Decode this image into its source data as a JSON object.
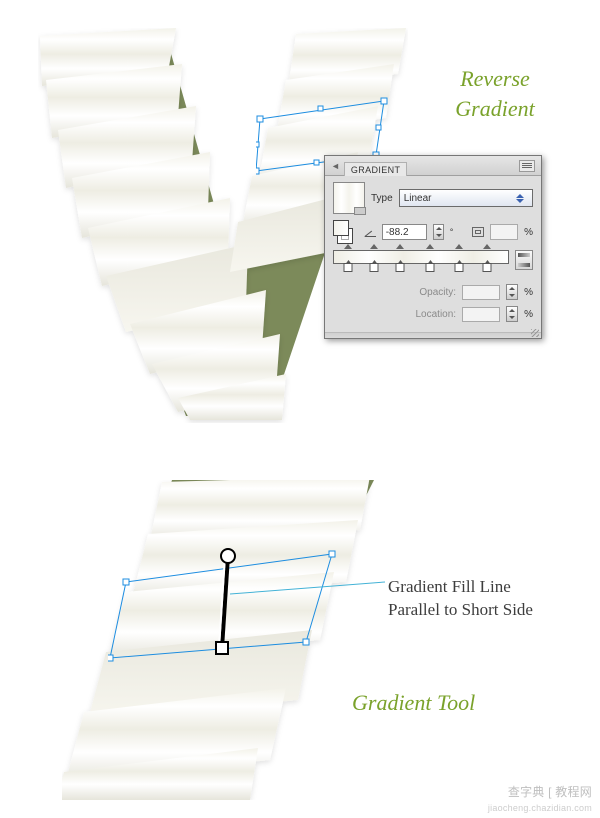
{
  "annotations": {
    "title1_line1": "Reverse",
    "title1_line2": "Gradient",
    "fill_line1": "Gradient Fill Line",
    "fill_line2": "Parallel to Short Side",
    "tool_title": "Gradient Tool"
  },
  "panel": {
    "name": "GRADIENT",
    "type_label": "Type",
    "type_value": "Linear",
    "angle_value": "-88.2",
    "degree_symbol": "°",
    "aspect_pct": "%",
    "opacity_label": "Opacity:",
    "opacity_pct": "%",
    "location_label": "Location:",
    "location_pct": "%",
    "stops_top_pct": [
      8,
      23,
      38,
      55,
      72,
      88
    ],
    "stops_bot_pct": [
      8,
      23,
      38,
      55,
      72,
      88
    ]
  },
  "watermark": {
    "line1": "查字典 [ 教程网",
    "line2": "jiaocheng.chazidian.com"
  }
}
